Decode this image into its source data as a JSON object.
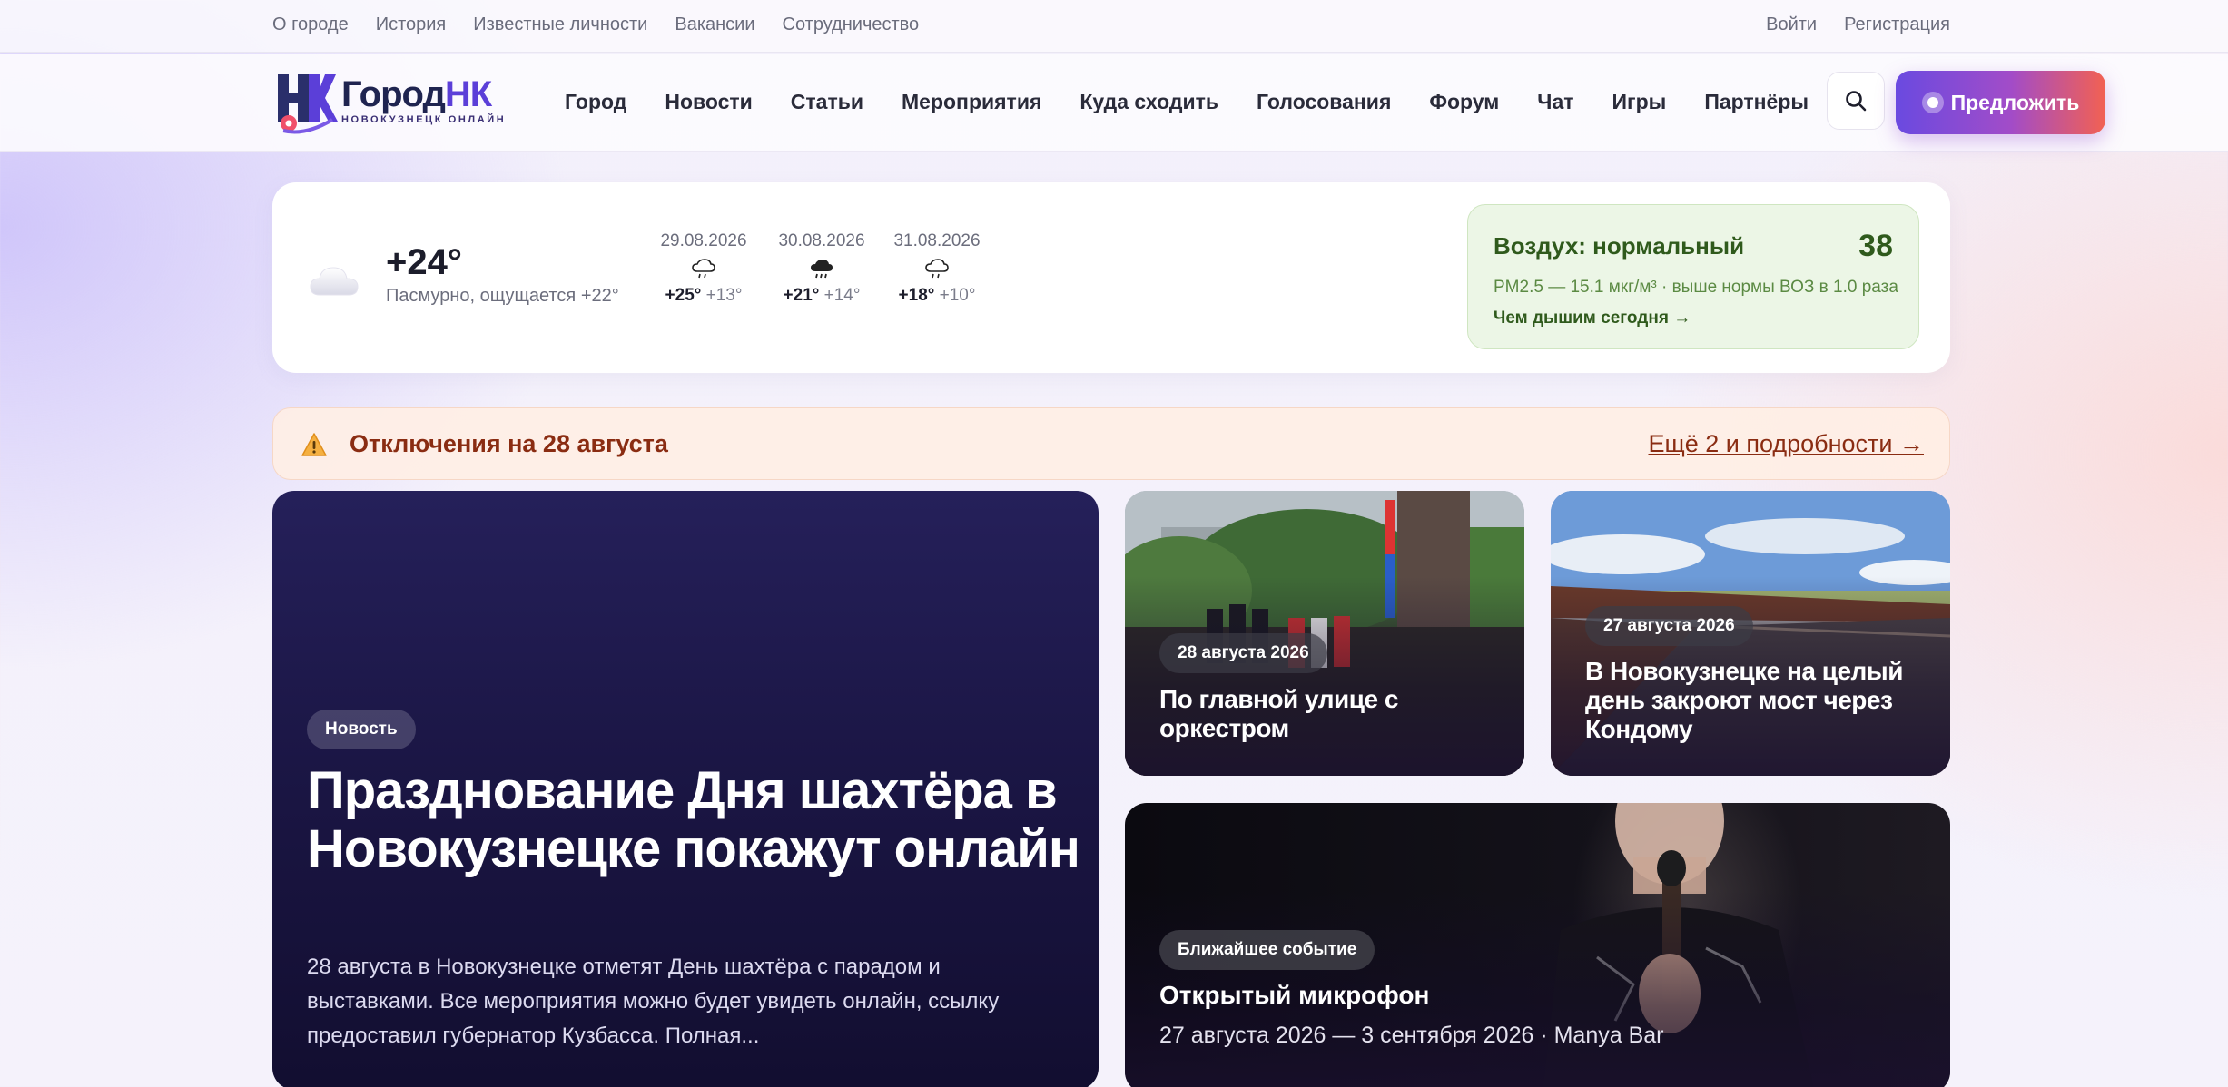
{
  "topbar": {
    "left_links": [
      "О городе",
      "История",
      "Известные личности",
      "Вакансии",
      "Сотрудничество"
    ],
    "right_links": [
      "Войти",
      "Регистрация"
    ]
  },
  "logo": {
    "mark": "НК",
    "title_word": "Город",
    "title_accent": "НК",
    "subtitle": "НОВОКУЗНЕЦК ОНЛАЙН"
  },
  "nav": {
    "items": [
      "Город",
      "Новости",
      "Статьи",
      "Мероприятия",
      "Куда сходить",
      "Голосования",
      "Форум",
      "Чат",
      "Игры",
      "Партнёры"
    ],
    "search_icon": "search-icon",
    "propose_label": "Предложить"
  },
  "weather": {
    "current_icon": "cloud-icon",
    "temp": "+24°",
    "description": "Пасмурно, ощущается +22°",
    "forecast": [
      {
        "date": "29.08.2026",
        "icon": "cloud-rain-icon",
        "hi": "+25°",
        "lo": "+13°"
      },
      {
        "date": "30.08.2026",
        "icon": "cloud-heavy-rain-icon",
        "hi": "+21°",
        "lo": "+14°"
      },
      {
        "date": "31.08.2026",
        "icon": "cloud-rain-icon",
        "hi": "+18°",
        "lo": "+10°"
      }
    ],
    "air": {
      "title": "Воздух: нормальный",
      "index": "38",
      "description": "PM2.5 — 15.1 мкг/м³ · выше нормы ВОЗ в 1.0 раза",
      "link": "Чем дышим сегодня →",
      "color": "#2f5a1c"
    }
  },
  "alert": {
    "icon": "warning-icon",
    "title": "Отключения на 28 августа",
    "more": "Ещё 2 и подробности →"
  },
  "feature": {
    "badge": "Новость",
    "title": "Празднование Дня шахтёра в Новокузнецке покажут онлайн",
    "description": "28 августа в Новокузнецке отметят День шахтёра с парадом и выставками. Все мероприятия можно будет увидеть онлайн, ссылку предоставил губернатор Кузбасса. Полная..."
  },
  "news": [
    {
      "date": "28 августа 2026",
      "title": "По главной улице с оркестром"
    },
    {
      "date": "27 августа 2026",
      "title": "В Новокузнецке на целый день закроют мост через Кондому"
    }
  ],
  "event": {
    "badge": "Ближайшее событие",
    "title": "Открытый микрофон",
    "meta": "27 августа 2026 — 3 сентября 2026 · Manya Bar"
  },
  "colors": {
    "brand_primary": "#5b3fd8",
    "brand_gradient_end": "#f26152",
    "alert_text": "#8a2c12"
  }
}
